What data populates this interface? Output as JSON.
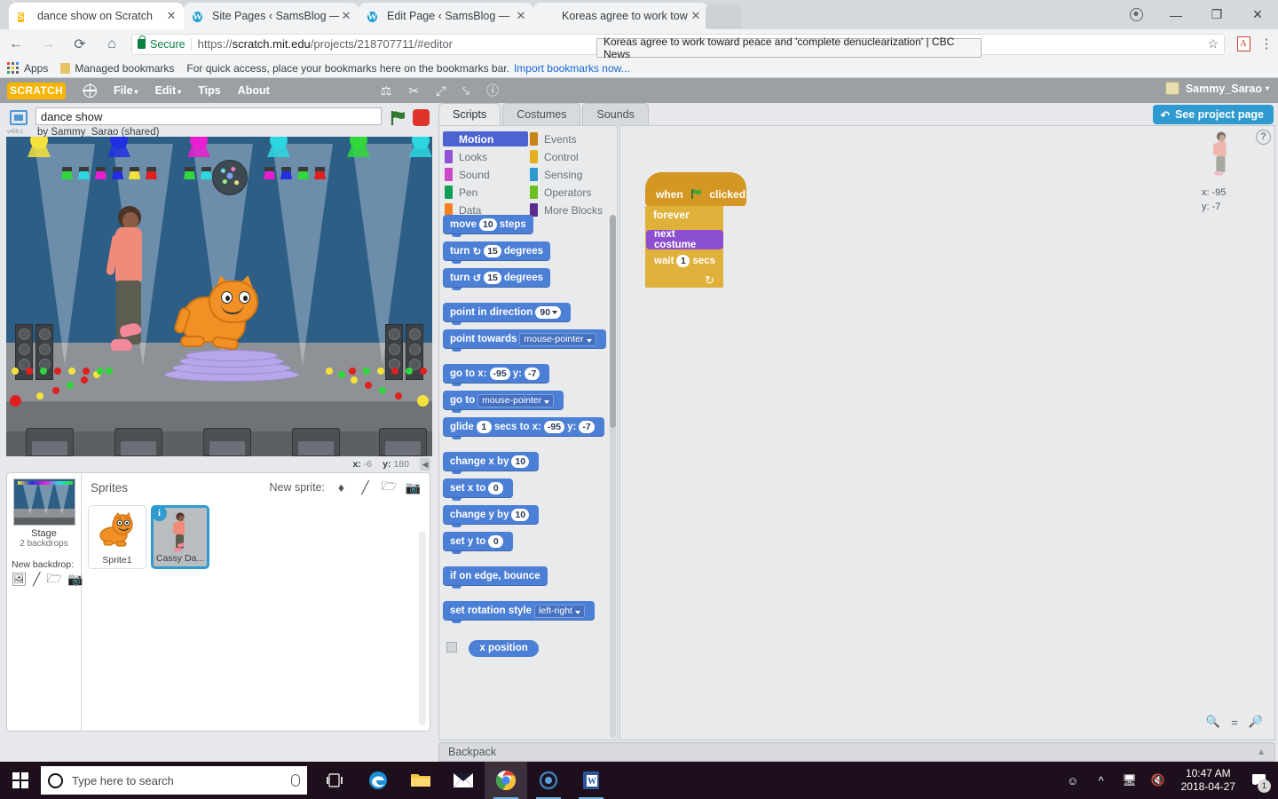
{
  "browser": {
    "tabs": [
      {
        "title": "dance show on Scratch",
        "favicon": "scratch-favicon",
        "active": true
      },
      {
        "title": "Site Pages ‹ SamsBlog —",
        "favicon": "wordpress-favicon",
        "active": false
      },
      {
        "title": "Edit Page ‹ SamsBlog —",
        "favicon": "wordpress-favicon",
        "active": false
      },
      {
        "title": "Koreas agree to work tow",
        "favicon": "cbc-favicon",
        "active": false
      }
    ],
    "tab_close_label": "✕",
    "address": {
      "secure_label": "Secure",
      "url_scheme": "https://",
      "url_host": "scratch.mit.edu",
      "url_path": "/projects/218707711/#editor"
    },
    "bookmarks": {
      "apps_label": "Apps",
      "managed_label": "Managed bookmarks",
      "hint": "For quick access, place your bookmarks here on the bookmarks bar.",
      "import_link": "Import bookmarks now..."
    },
    "tooltip": "Koreas agree to work toward peace and 'complete denuclearization' | CBC News",
    "window_controls": {
      "minimize": "—",
      "maximize": "❐",
      "close": "✕"
    }
  },
  "scratch": {
    "menu": {
      "logo": "SCRATCH",
      "items": [
        "File",
        "Edit",
        "Tips",
        "About"
      ],
      "caret": "▾",
      "tools": [
        "stamp-duplicate-icon",
        "scissors-delete-icon",
        "grow-icon",
        "shrink-icon",
        "help-icon"
      ],
      "username": "Sammy_Sarao",
      "user_caret": "▾"
    },
    "project": {
      "title_value": "dance show",
      "author_line": "by Sammy_Sarao (shared)",
      "version_tag": "v459.1",
      "green_flag": "green-flag-icon",
      "stop": "stop-icon"
    },
    "stage": {
      "mouse_x_label": "x:",
      "mouse_x_value": "-6",
      "mouse_y_label": "y:",
      "mouse_y_value": "180"
    },
    "sprites_pane": {
      "title": "Sprites",
      "new_sprite_label": "New sprite:",
      "new_sprite_icons": [
        "choose-sprite-icon",
        "paint-sprite-icon",
        "upload-sprite-icon",
        "camera-sprite-icon"
      ],
      "stage_label": "Stage",
      "stage_sub": "2 backdrops",
      "new_backdrop_label": "New backdrop:",
      "new_backdrop_icons": [
        "choose-backdrop-icon",
        "paint-backdrop-icon",
        "upload-backdrop-icon",
        "camera-backdrop-icon"
      ],
      "sprites": [
        {
          "name": "Sprite1",
          "selected": false,
          "thumb": "cat-thumb"
        },
        {
          "name": "Cassy Da...",
          "selected": true,
          "thumb": "dancer-thumb",
          "info_badge": "i"
        }
      ]
    },
    "editor": {
      "tabs": [
        {
          "label": "Scripts",
          "active": true
        },
        {
          "label": "Costumes",
          "active": false
        },
        {
          "label": "Sounds",
          "active": false
        }
      ],
      "see_project_page": "See project page",
      "see_project_icon": "back-arrows-icon",
      "help_icon": "question-mark-icon",
      "zoom_controls": [
        "zoom-out-icon",
        "zoom-reset-icon",
        "zoom-in-icon"
      ],
      "backpack_label": "Backpack",
      "backpack_arrow": "▲"
    },
    "sprite_info": {
      "x_label": "x:",
      "x_value": "-95",
      "y_label": "y:",
      "y_value": "-7"
    },
    "palette": {
      "categories_left": [
        {
          "label": "Motion",
          "color": "#4c63d2",
          "selected": true
        },
        {
          "label": "Looks",
          "color": "#9152d8",
          "selected": false
        },
        {
          "label": "Sound",
          "color": "#cc48c9",
          "selected": false
        },
        {
          "label": "Pen",
          "color": "#0f9d58",
          "selected": false
        },
        {
          "label": "Data",
          "color": "#f58220",
          "selected": false
        }
      ],
      "categories_right": [
        {
          "label": "Events",
          "color": "#c98316",
          "selected": false
        },
        {
          "label": "Control",
          "color": "#e5b01f",
          "selected": false
        },
        {
          "label": "Sensing",
          "color": "#2e9ad0",
          "selected": false
        },
        {
          "label": "Operators",
          "color": "#6cc020",
          "selected": false
        },
        {
          "label": "More Blocks",
          "color": "#5b2d90",
          "selected": false
        }
      ],
      "blocks": [
        {
          "id": "move",
          "parts": [
            {
              "t": "move"
            },
            {
              "n": "10"
            },
            {
              "t": "steps"
            }
          ]
        },
        {
          "id": "turn-cw",
          "parts": [
            {
              "t": "turn"
            },
            {
              "t": "↻"
            },
            {
              "n": "15"
            },
            {
              "t": "degrees"
            }
          ]
        },
        {
          "id": "turn-ccw",
          "parts": [
            {
              "t": "turn"
            },
            {
              "t": "↺"
            },
            {
              "n": "15"
            },
            {
              "t": "degrees"
            }
          ]
        },
        {
          "id": "point-in-direction",
          "gap_before": true,
          "parts": [
            {
              "t": "point in direction"
            },
            {
              "nd": "90"
            }
          ]
        },
        {
          "id": "point-towards",
          "parts": [
            {
              "t": "point towards"
            },
            {
              "d": "mouse-pointer"
            }
          ]
        },
        {
          "id": "go-to-xy",
          "gap_before": true,
          "parts": [
            {
              "t": "go to x:"
            },
            {
              "n": "-95"
            },
            {
              "t": "y:"
            },
            {
              "n": "-7"
            }
          ]
        },
        {
          "id": "go-to",
          "parts": [
            {
              "t": "go to"
            },
            {
              "d": "mouse-pointer"
            }
          ]
        },
        {
          "id": "glide",
          "parts": [
            {
              "t": "glide"
            },
            {
              "n": "1"
            },
            {
              "t": "secs to x:"
            },
            {
              "n": "-95"
            },
            {
              "t": "y:"
            },
            {
              "n": "-7"
            }
          ]
        },
        {
          "id": "change-x",
          "gap_before": true,
          "parts": [
            {
              "t": "change x by"
            },
            {
              "n": "10"
            }
          ]
        },
        {
          "id": "set-x",
          "parts": [
            {
              "t": "set x to"
            },
            {
              "n": "0"
            }
          ]
        },
        {
          "id": "change-y",
          "parts": [
            {
              "t": "change y by"
            },
            {
              "n": "10"
            }
          ]
        },
        {
          "id": "set-y",
          "parts": [
            {
              "t": "set y to"
            },
            {
              "n": "0"
            }
          ]
        },
        {
          "id": "if-on-edge",
          "gap_before": true,
          "parts": [
            {
              "t": "if on edge, bounce"
            }
          ]
        },
        {
          "id": "set-rotation-style",
          "gap_before": true,
          "parts": [
            {
              "t": "set rotation style"
            },
            {
              "d": "left-right"
            }
          ]
        }
      ],
      "reporters": [
        {
          "id": "x-position",
          "label": "x position",
          "checked": false
        }
      ]
    },
    "script": {
      "hat_when": "when",
      "hat_flag": "green-flag-icon",
      "hat_clicked": "clicked",
      "forever": "forever",
      "next_costume": "next costume",
      "wait": "wait",
      "wait_value": "1",
      "secs": "secs",
      "loop_arrow": "↻"
    }
  },
  "taskbar": {
    "search_placeholder": "Type here to search",
    "icons": [
      "task-view-icon",
      "edge-icon",
      "file-explorer-icon",
      "mail-icon",
      "chrome-icon",
      "cortana-icon",
      "word-icon"
    ],
    "tray": [
      "people-icon",
      "show-hidden-icons-icon",
      "network-icon",
      "volume-muted-icon"
    ],
    "time": "10:47 AM",
    "date": "2018-04-27",
    "notification_count": "1"
  }
}
